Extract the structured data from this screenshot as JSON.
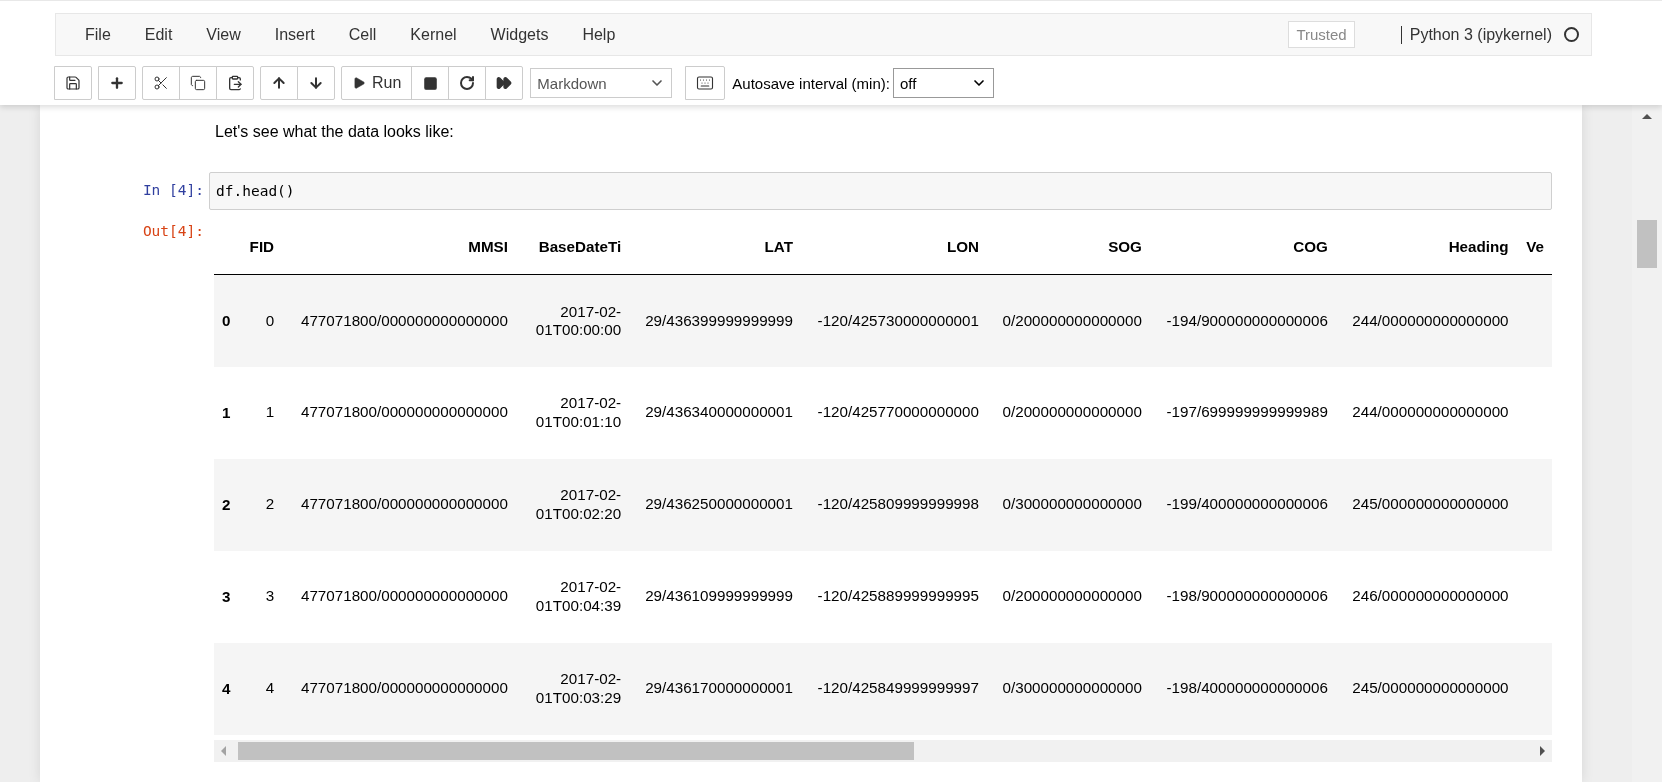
{
  "menu": [
    {
      "label": "File"
    },
    {
      "label": "Edit"
    },
    {
      "label": "View"
    },
    {
      "label": "Insert"
    },
    {
      "label": "Cell"
    },
    {
      "label": "Kernel"
    },
    {
      "label": "Widgets"
    },
    {
      "label": "Help"
    }
  ],
  "trusted": {
    "label": "Trusted"
  },
  "kernel": {
    "name": "Python 3 (ipykernel)",
    "busy": false
  },
  "toolbar": {
    "run_label": "Run",
    "cell_type": "Markdown",
    "autosave_label": "Autosave interval (min):",
    "autosave_value": "off"
  },
  "markdown_text": "Let's see what the data looks like:",
  "input_cell": {
    "prompt": "In [4]:",
    "code": "df.head()"
  },
  "output_cell": {
    "prompt": "Out[4]:"
  },
  "table": {
    "columns": [
      "FID",
      "MMSI",
      "BaseDateTi",
      "LAT",
      "LON",
      "SOG",
      "COG",
      "Heading",
      "Ve"
    ],
    "rows": [
      {
        "index": "0",
        "cells": [
          "0",
          "477071800/000000000000000",
          "2017-02-01T00:00:00",
          "29/436399999999999",
          "-120/425730000000001",
          "0/200000000000000",
          "-194/900000000000006",
          "244/000000000000000"
        ]
      },
      {
        "index": "1",
        "cells": [
          "1",
          "477071800/000000000000000",
          "2017-02-01T00:01:10",
          "29/436340000000001",
          "-120/425770000000000",
          "0/200000000000000",
          "-197/699999999999989",
          "244/000000000000000"
        ]
      },
      {
        "index": "2",
        "cells": [
          "2",
          "477071800/000000000000000",
          "2017-02-01T00:02:20",
          "29/436250000000001",
          "-120/425809999999998",
          "0/300000000000000",
          "-199/400000000000006",
          "245/000000000000000"
        ]
      },
      {
        "index": "3",
        "cells": [
          "3",
          "477071800/000000000000000",
          "2017-02-01T00:04:39",
          "29/436109999999999",
          "-120/425889999999995",
          "0/200000000000000",
          "-198/900000000000006",
          "246/000000000000000"
        ]
      },
      {
        "index": "4",
        "cells": [
          "4",
          "477071800/000000000000000",
          "2017-02-01T00:03:29",
          "29/436170000000001",
          "-120/425849999999997",
          "0/300000000000000",
          "-198/400000000000006",
          "245/000000000000000"
        ]
      }
    ]
  }
}
